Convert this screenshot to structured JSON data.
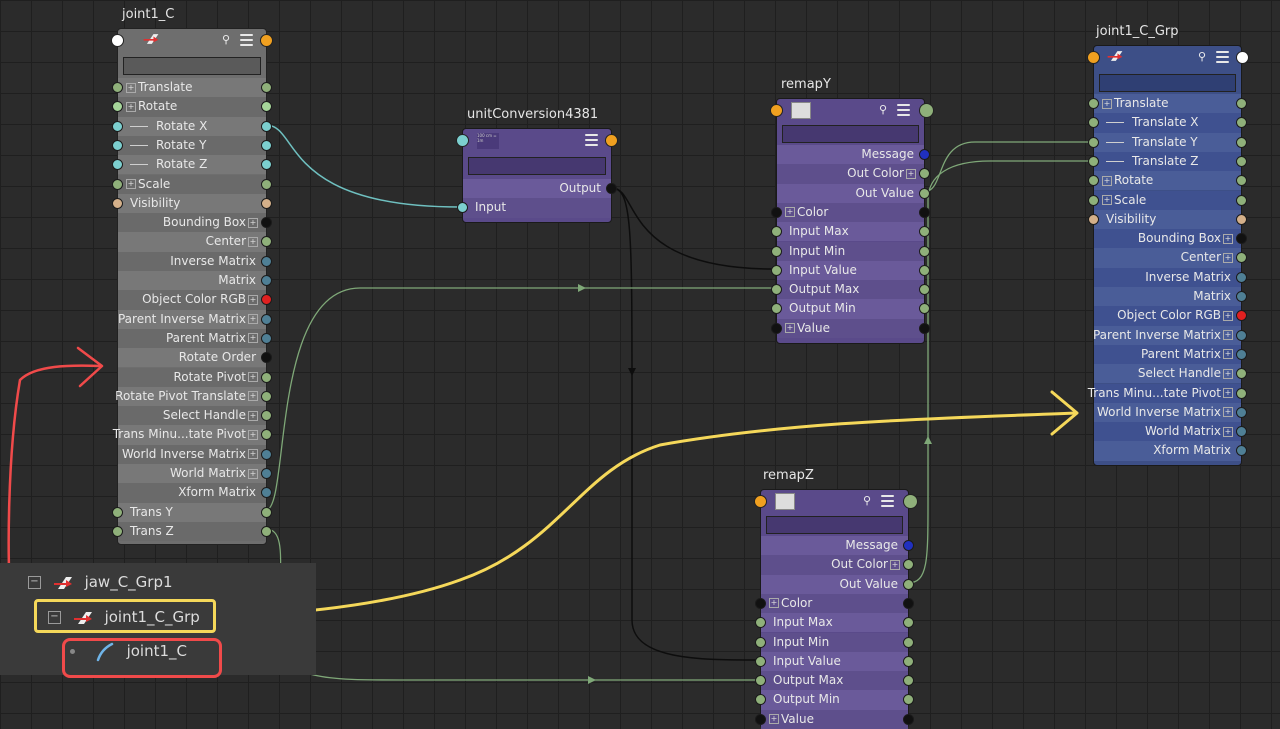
{
  "nodes": {
    "joint1_C": {
      "title": "joint1_C",
      "rows": [
        {
          "label": "Translate",
          "align": "left",
          "expander": "left",
          "indent": 0,
          "left": "#8fb07a",
          "right": "#8fb07a"
        },
        {
          "label": "Rotate",
          "align": "left",
          "expander": "left",
          "indent": 0,
          "left": "#a6d69a",
          "right": "#a6d69a"
        },
        {
          "label": "Rotate X",
          "align": "left",
          "expander": "",
          "indent": 1,
          "left": "#7ccfcf",
          "right": "#7ccfcf"
        },
        {
          "label": "Rotate Y",
          "align": "left",
          "expander": "",
          "indent": 1,
          "left": "#7ccfcf",
          "right": "#7ccfcf"
        },
        {
          "label": "Rotate Z",
          "align": "left",
          "expander": "",
          "indent": 1,
          "left": "#7ccfcf",
          "right": "#7ccfcf"
        },
        {
          "label": "Scale",
          "align": "left",
          "expander": "left",
          "indent": 0,
          "left": "#8fb07a",
          "right": "#8fb07a"
        },
        {
          "label": "Visibility",
          "align": "left",
          "expander": "",
          "indent": 0,
          "left": "#d4b08a",
          "right": "#d4b08a"
        },
        {
          "label": "Bounding Box",
          "align": "right",
          "expander": "right",
          "indent": 0,
          "left": "",
          "right": "#111111"
        },
        {
          "label": "Center",
          "align": "right",
          "expander": "right",
          "indent": 0,
          "left": "",
          "right": "#8fb07a"
        },
        {
          "label": "Inverse Matrix",
          "align": "right",
          "expander": "",
          "indent": 0,
          "left": "",
          "right": "#4f7f95"
        },
        {
          "label": "Matrix",
          "align": "right",
          "expander": "",
          "indent": 0,
          "left": "",
          "right": "#4f7f95"
        },
        {
          "label": "Object Color RGB",
          "align": "right",
          "expander": "right",
          "indent": 0,
          "left": "",
          "right": "#e02020"
        },
        {
          "label": "Parent Inverse Matrix",
          "align": "right",
          "expander": "right",
          "indent": 0,
          "left": "",
          "right": "#4f7f95"
        },
        {
          "label": "Parent Matrix",
          "align": "right",
          "expander": "right",
          "indent": 0,
          "left": "",
          "right": "#4f7f95"
        },
        {
          "label": "Rotate Order",
          "align": "right",
          "expander": "",
          "indent": 0,
          "left": "",
          "right": "#111111"
        },
        {
          "label": "Rotate Pivot",
          "align": "right",
          "expander": "right",
          "indent": 0,
          "left": "",
          "right": "#8fb07a"
        },
        {
          "label": "Rotate Pivot Translate",
          "align": "right",
          "expander": "right",
          "indent": 0,
          "left": "",
          "right": "#8fb07a"
        },
        {
          "label": "Select Handle",
          "align": "right",
          "expander": "right",
          "indent": 0,
          "left": "",
          "right": "#8fb07a"
        },
        {
          "label": "Trans Minu...tate Pivot",
          "align": "right",
          "expander": "right",
          "indent": 0,
          "left": "",
          "right": "#8fb07a"
        },
        {
          "label": "World Inverse Matrix",
          "align": "right",
          "expander": "right",
          "indent": 0,
          "left": "",
          "right": "#4f7f95"
        },
        {
          "label": "World Matrix",
          "align": "right",
          "expander": "right",
          "indent": 0,
          "left": "",
          "right": "#4f7f95"
        },
        {
          "label": "Xform Matrix",
          "align": "right",
          "expander": "",
          "indent": 0,
          "left": "",
          "right": "#4f7f95"
        },
        {
          "label": "Trans Y",
          "align": "left",
          "expander": "",
          "indent": 0,
          "left": "#8fb07a",
          "right": "#8fb07a"
        },
        {
          "label": "Trans Z",
          "align": "left",
          "expander": "",
          "indent": 0,
          "left": "#8fb07a",
          "right": "#8fb07a"
        }
      ]
    },
    "unitConversion": {
      "title": "unitConversion4381",
      "icon_text": "100 cm = 1m",
      "rows": [
        {
          "label": "Output",
          "align": "right",
          "expander": "",
          "indent": 0,
          "left": "",
          "right": "#111111"
        },
        {
          "label": "Input",
          "align": "left",
          "expander": "",
          "indent": 0,
          "left": "#7ccfcf",
          "right": ""
        }
      ]
    },
    "remapY": {
      "title": "remapY",
      "rows": [
        {
          "label": "Message",
          "align": "right",
          "expander": "",
          "indent": 0,
          "left": "",
          "right": "#2030c0"
        },
        {
          "label": "Out Color",
          "align": "right",
          "expander": "right",
          "indent": 0,
          "left": "",
          "right": "#8fb07a"
        },
        {
          "label": "Out Value",
          "align": "right",
          "expander": "",
          "indent": 0,
          "left": "",
          "right": "#8fb07a"
        },
        {
          "label": "Color",
          "align": "left",
          "expander": "left",
          "indent": 0,
          "left": "#111111",
          "right": "#111111"
        },
        {
          "label": "Input Max",
          "align": "left",
          "expander": "",
          "indent": 0,
          "left": "#8fb07a",
          "right": "#8fb07a"
        },
        {
          "label": "Input Min",
          "align": "left",
          "expander": "",
          "indent": 0,
          "left": "#8fb07a",
          "right": "#8fb07a"
        },
        {
          "label": "Input Value",
          "align": "left",
          "expander": "",
          "indent": 0,
          "left": "#8fb07a",
          "right": "#8fb07a"
        },
        {
          "label": "Output Max",
          "align": "left",
          "expander": "",
          "indent": 0,
          "left": "#8fb07a",
          "right": "#8fb07a"
        },
        {
          "label": "Output Min",
          "align": "left",
          "expander": "",
          "indent": 0,
          "left": "#8fb07a",
          "right": "#8fb07a"
        },
        {
          "label": "Value",
          "align": "left",
          "expander": "left",
          "indent": 0,
          "left": "#111111",
          "right": "#111111"
        }
      ]
    },
    "remapZ": {
      "title": "remapZ",
      "rows": [
        {
          "label": "Message",
          "align": "right",
          "expander": "",
          "indent": 0,
          "left": "",
          "right": "#2030c0"
        },
        {
          "label": "Out Color",
          "align": "right",
          "expander": "right",
          "indent": 0,
          "left": "",
          "right": "#8fb07a"
        },
        {
          "label": "Out Value",
          "align": "right",
          "expander": "",
          "indent": 0,
          "left": "",
          "right": "#8fb07a"
        },
        {
          "label": "Color",
          "align": "left",
          "expander": "left",
          "indent": 0,
          "left": "#111111",
          "right": "#111111"
        },
        {
          "label": "Input Max",
          "align": "left",
          "expander": "",
          "indent": 0,
          "left": "#8fb07a",
          "right": "#8fb07a"
        },
        {
          "label": "Input Min",
          "align": "left",
          "expander": "",
          "indent": 0,
          "left": "#8fb07a",
          "right": "#8fb07a"
        },
        {
          "label": "Input Value",
          "align": "left",
          "expander": "",
          "indent": 0,
          "left": "#8fb07a",
          "right": "#8fb07a"
        },
        {
          "label": "Output Max",
          "align": "left",
          "expander": "",
          "indent": 0,
          "left": "#8fb07a",
          "right": "#8fb07a"
        },
        {
          "label": "Output Min",
          "align": "left",
          "expander": "",
          "indent": 0,
          "left": "#8fb07a",
          "right": "#8fb07a"
        },
        {
          "label": "Value",
          "align": "left",
          "expander": "left",
          "indent": 0,
          "left": "#111111",
          "right": "#111111"
        }
      ]
    },
    "joint1_C_Grp": {
      "title": "joint1_C_Grp",
      "rows": [
        {
          "label": "Translate",
          "align": "left",
          "expander": "left",
          "indent": 0,
          "left": "#8fb07a",
          "right": "#8fb07a"
        },
        {
          "label": "Translate X",
          "align": "left",
          "expander": "",
          "indent": 1,
          "left": "#8fb07a",
          "right": "#8fb07a"
        },
        {
          "label": "Translate Y",
          "align": "left",
          "expander": "",
          "indent": 1,
          "left": "#8fb07a",
          "right": "#8fb07a"
        },
        {
          "label": "Translate Z",
          "align": "left",
          "expander": "",
          "indent": 1,
          "left": "#8fb07a",
          "right": "#8fb07a"
        },
        {
          "label": "Rotate",
          "align": "left",
          "expander": "left",
          "indent": 0,
          "left": "#8fb07a",
          "right": "#8fb07a"
        },
        {
          "label": "Scale",
          "align": "left",
          "expander": "left",
          "indent": 0,
          "left": "#8fb07a",
          "right": "#8fb07a"
        },
        {
          "label": "Visibility",
          "align": "left",
          "expander": "",
          "indent": 0,
          "left": "#d4b08a",
          "right": "#d4b08a"
        },
        {
          "label": "Bounding Box",
          "align": "right",
          "expander": "right",
          "indent": 0,
          "left": "",
          "right": "#111111"
        },
        {
          "label": "Center",
          "align": "right",
          "expander": "right",
          "indent": 0,
          "left": "",
          "right": "#8fb07a"
        },
        {
          "label": "Inverse Matrix",
          "align": "right",
          "expander": "",
          "indent": 0,
          "left": "",
          "right": "#4f7f95"
        },
        {
          "label": "Matrix",
          "align": "right",
          "expander": "",
          "indent": 0,
          "left": "",
          "right": "#4f7f95"
        },
        {
          "label": "Object Color RGB",
          "align": "right",
          "expander": "right",
          "indent": 0,
          "left": "",
          "right": "#e02020"
        },
        {
          "label": "Parent Inverse Matrix",
          "align": "right",
          "expander": "right",
          "indent": 0,
          "left": "",
          "right": "#4f7f95"
        },
        {
          "label": "Parent Matrix",
          "align": "right",
          "expander": "right",
          "indent": 0,
          "left": "",
          "right": "#4f7f95"
        },
        {
          "label": "Select Handle",
          "align": "right",
          "expander": "right",
          "indent": 0,
          "left": "",
          "right": "#8fb07a"
        },
        {
          "label": "Trans Minu...tate Pivot",
          "align": "right",
          "expander": "right",
          "indent": 0,
          "left": "",
          "right": "#8fb07a"
        },
        {
          "label": "World Inverse Matrix",
          "align": "right",
          "expander": "right",
          "indent": 0,
          "left": "",
          "right": "#4f7f95"
        },
        {
          "label": "World Matrix",
          "align": "right",
          "expander": "right",
          "indent": 0,
          "left": "",
          "right": "#4f7f95"
        },
        {
          "label": "Xform Matrix",
          "align": "right",
          "expander": "",
          "indent": 0,
          "left": "",
          "right": "#4f7f95"
        }
      ]
    }
  },
  "outliner": {
    "items": [
      {
        "label": "jaw_C_Grp1",
        "expander": "−",
        "icon": "transform-icon"
      },
      {
        "label": "joint1_C_Grp",
        "expander": "−",
        "icon": "transform-icon"
      },
      {
        "label": "joint1_C",
        "expander": "",
        "icon": "joint-icon"
      }
    ]
  },
  "colors": {
    "grid_bg": "#2b2b2b",
    "joint_node": "#6e6e6e",
    "shader_node": "#5a4a8a",
    "grp_node": "#3d4f87",
    "wire_cyan": "#6fc0c0",
    "wire_green": "#7fa878",
    "wire_black": "#0d0d0d",
    "annotation_yellow": "#f5d85a",
    "annotation_red": "#f04a4a",
    "header_orange": "#f0a020"
  }
}
